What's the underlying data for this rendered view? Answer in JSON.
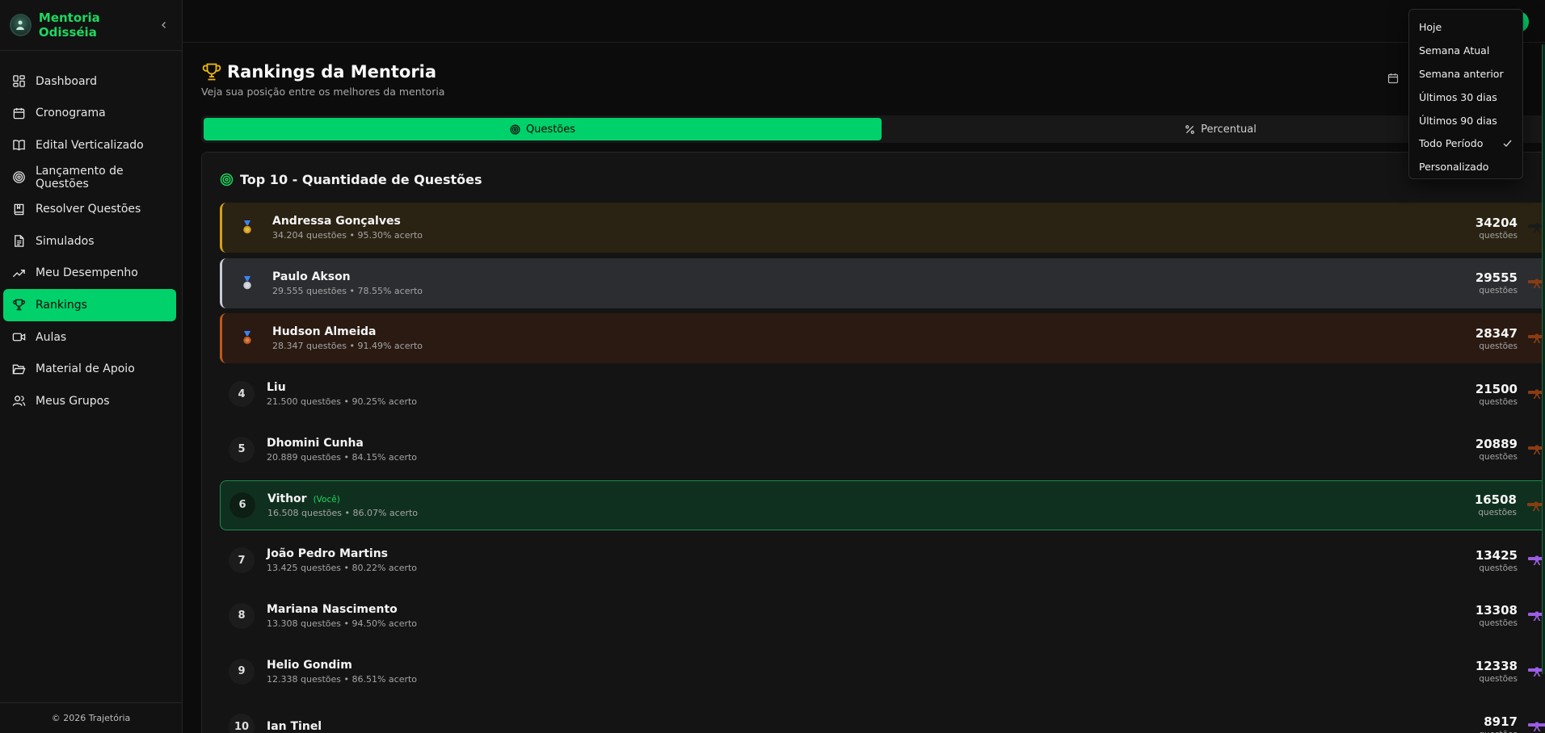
{
  "brand": {
    "title": "Mentoria Odisséia"
  },
  "sidebar": {
    "items": [
      {
        "label": "Dashboard",
        "icon": "dashboard-icon"
      },
      {
        "label": "Cronograma",
        "icon": "calendar-icon"
      },
      {
        "label": "Edital Verticalizado",
        "icon": "book-open-icon"
      },
      {
        "label": "Lançamento de Questões",
        "icon": "target-icon"
      },
      {
        "label": "Resolver Questões",
        "icon": "book-icon"
      },
      {
        "label": "Simulados",
        "icon": "file-text-icon"
      },
      {
        "label": "Meu Desempenho",
        "icon": "trending-up-icon"
      },
      {
        "label": "Rankings",
        "icon": "trophy-icon",
        "active": true
      },
      {
        "label": "Aulas",
        "icon": "video-icon"
      },
      {
        "label": "Material de Apoio",
        "icon": "folder-icon"
      },
      {
        "label": "Meus Grupos",
        "icon": "users-icon"
      }
    ],
    "footer": "© 2026 Trajetória"
  },
  "header": {
    "title": "Rankings da Mentoria",
    "subtitle": "Veja sua posição entre os melhores da mentoria"
  },
  "tabs": [
    {
      "label": "Questões",
      "active": true
    },
    {
      "label": "Percentual",
      "active": false
    }
  ],
  "card": {
    "title": "Top 10 - Quantidade de Questões"
  },
  "ranking": [
    {
      "rank": "1",
      "name": "Andressa Gonçalves",
      "stats": "34.204 questões • 95.30% acerto",
      "score": "34204",
      "unit": "questões",
      "style": "gold",
      "belt_color": "#1a1a1a"
    },
    {
      "rank": "2",
      "name": "Paulo Akson",
      "stats": "29.555 questões • 78.55% acerto",
      "score": "29555",
      "unit": "questões",
      "style": "silver",
      "belt_color": "#8a3b12"
    },
    {
      "rank": "3",
      "name": "Hudson Almeida",
      "stats": "28.347 questões • 91.49% acerto",
      "score": "28347",
      "unit": "questões",
      "style": "bronze",
      "belt_color": "#8a3b12"
    },
    {
      "rank": "4",
      "name": "Liu",
      "stats": "21.500 questões • 90.25% acerto",
      "score": "21500",
      "unit": "questões",
      "style": "normal",
      "belt_color": "#8a3b12"
    },
    {
      "rank": "5",
      "name": "Dhomini Cunha",
      "stats": "20.889 questões • 84.15% acerto",
      "score": "20889",
      "unit": "questões",
      "style": "normal",
      "belt_color": "#8a3b12"
    },
    {
      "rank": "6",
      "name": "Vithor",
      "you_label": "(Você)",
      "stats": "16.508 questões • 86.07% acerto",
      "score": "16508",
      "unit": "questões",
      "style": "you",
      "belt_color": "#8a3b12"
    },
    {
      "rank": "7",
      "name": "João Pedro Martins",
      "stats": "13.425 questões • 80.22% acerto",
      "score": "13425",
      "unit": "questões",
      "style": "normal",
      "belt_color": "#9b5de5"
    },
    {
      "rank": "8",
      "name": "Mariana Nascimento",
      "stats": "13.308 questões • 94.50% acerto",
      "score": "13308",
      "unit": "questões",
      "style": "normal",
      "belt_color": "#9b5de5"
    },
    {
      "rank": "9",
      "name": "Helio Gondim",
      "stats": "12.338 questões • 86.51% acerto",
      "score": "12338",
      "unit": "questões",
      "style": "normal",
      "belt_color": "#9b5de5"
    },
    {
      "rank": "10",
      "name": "Ian Tinel",
      "stats": "",
      "score": "8917",
      "unit": "questões",
      "style": "normal",
      "belt_color": "#9b5de5"
    }
  ],
  "period_menu": {
    "options": [
      "Hoje",
      "Semana Atual",
      "Semana anterior",
      "Últimos 30 dias",
      "Últimos 90 dias",
      "Todo Período",
      "Personalizado"
    ],
    "selected": "Todo Período"
  },
  "colors": {
    "accent": "#00d16a",
    "gold": "#d4a017",
    "silver": "#c9ccd4",
    "bronze": "#c0581b"
  }
}
